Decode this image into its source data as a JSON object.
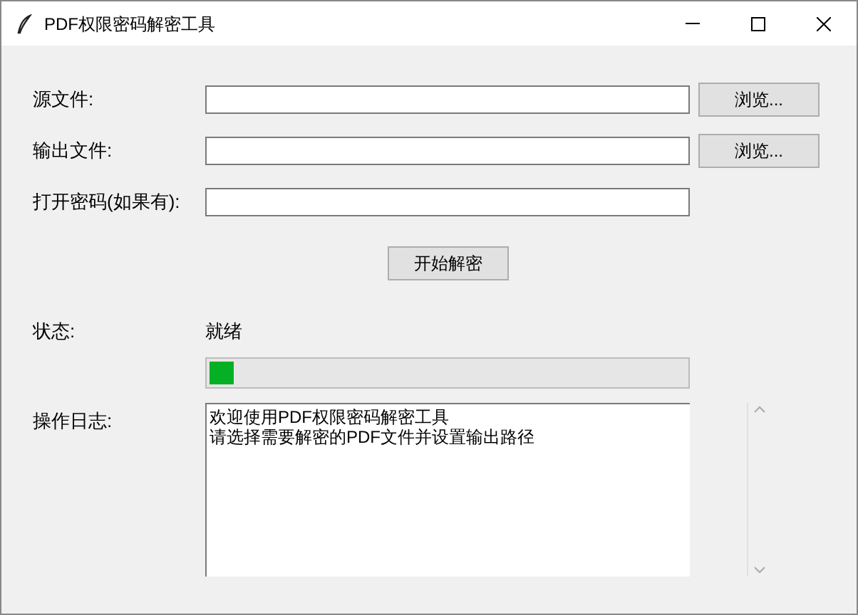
{
  "window": {
    "title": "PDF权限密码解密工具"
  },
  "fields": [
    {
      "label": "源文件:",
      "button": "浏览..."
    },
    {
      "label": "输出文件:",
      "button": "浏览..."
    },
    {
      "label": "打开密码(如果有):"
    }
  ],
  "start_button": "开始解密",
  "status": {
    "label": "状态:",
    "value": "就绪"
  },
  "progress": {
    "level": 0.05
  },
  "log": {
    "label": "操作日志:",
    "lines": [
      "欢迎使用PDF权限密码解密工具",
      "请选择需要解密的PDF文件并设置输出路径"
    ]
  }
}
